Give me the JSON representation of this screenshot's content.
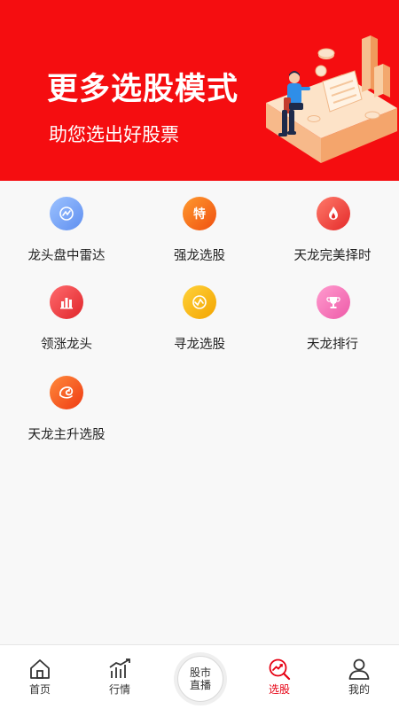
{
  "banner": {
    "title": "更多选股模式",
    "subtitle": "助您选出好股票",
    "background": "#f50d10"
  },
  "features": [
    {
      "label": "龙头盘中雷达",
      "icon": "radar-icon",
      "color": "#6f9df5"
    },
    {
      "label": "强龙选股",
      "icon": "special-tag-icon",
      "color": "#f36a10"
    },
    {
      "label": "天龙完美择时",
      "icon": "fire-drop-icon",
      "color": "#ee3b3b"
    },
    {
      "label": "领涨龙头",
      "icon": "bar-chart-icon",
      "color": "#ef3a3e"
    },
    {
      "label": "寻龙选股",
      "icon": "wave-icon",
      "color": "#f6b300"
    },
    {
      "label": "天龙排行",
      "icon": "trophy-icon",
      "color": "#f56cb3"
    },
    {
      "label": "天龙主升选股",
      "icon": "dragon-icon",
      "color": "#f55a1a"
    }
  ],
  "center_button": {
    "line1": "股市",
    "line2": "直播"
  },
  "nav": [
    {
      "label": "首页",
      "icon": "home-icon",
      "active": false
    },
    {
      "label": "行情",
      "icon": "market-chart-icon",
      "active": false
    },
    {
      "label": "选股",
      "icon": "stock-pick-icon",
      "active": true
    },
    {
      "label": "我的",
      "icon": "profile-icon",
      "active": false
    }
  ],
  "accent": "#e60012"
}
